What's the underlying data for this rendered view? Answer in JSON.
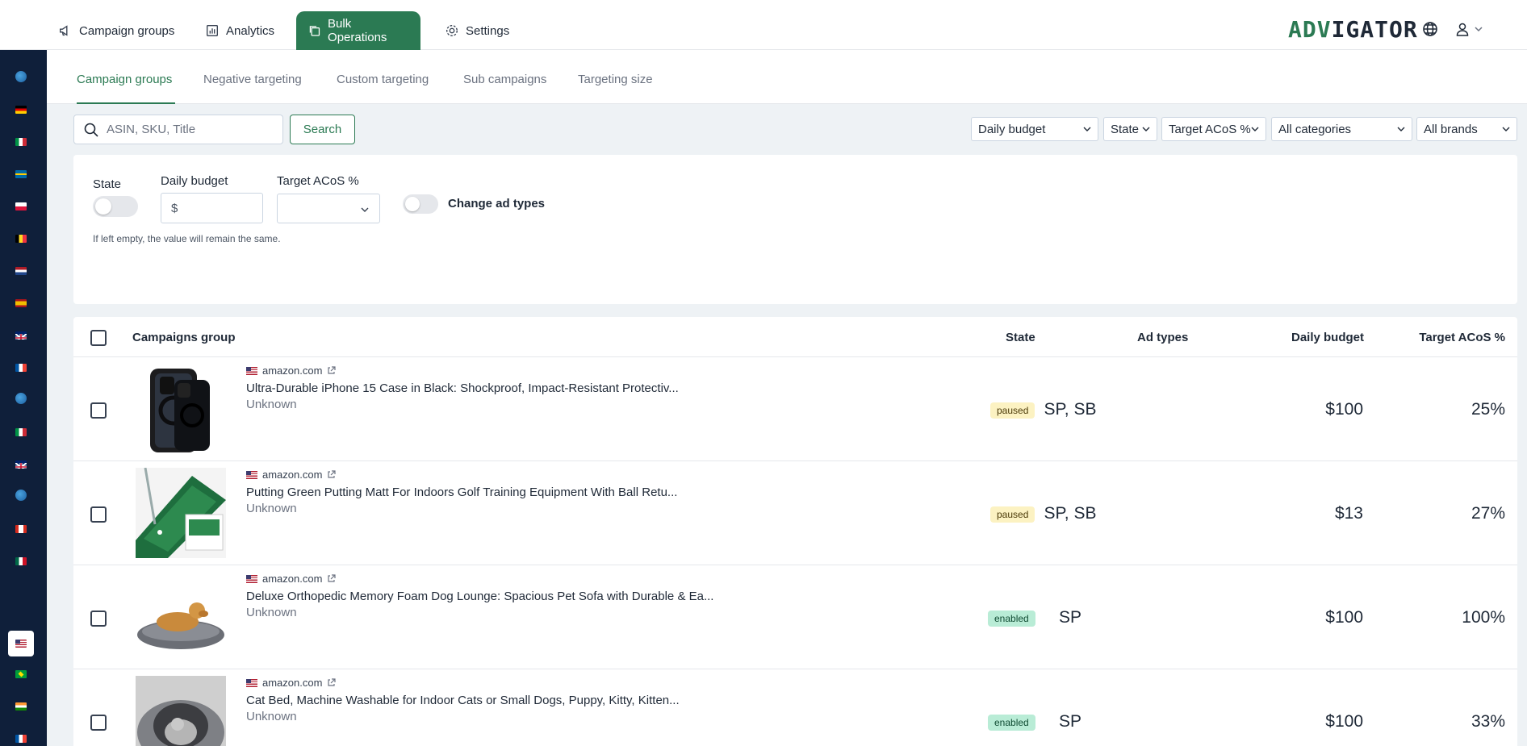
{
  "nav": {
    "items": [
      {
        "label": "Campaign groups",
        "icon": "megaphone-icon"
      },
      {
        "label": "Analytics",
        "icon": "chart-icon"
      },
      {
        "label": "Bulk Operations",
        "icon": "copy-icon",
        "active": true
      },
      {
        "label": "Settings",
        "icon": "gear-icon"
      }
    ],
    "logo_part1": "ADV",
    "logo_part2": "IGATOR",
    "accent": "#2b7a53"
  },
  "subtabs": [
    "Campaign groups",
    "Negative targeting",
    "Custom targeting",
    "Sub campaigns",
    "Targeting size"
  ],
  "search": {
    "placeholder": "ASIN, SKU, Title",
    "button": "Search"
  },
  "filters": [
    "Daily budget",
    "State",
    "Target ACoS %",
    "All categories",
    "All brands"
  ],
  "panel": {
    "state_label": "State",
    "budget_label": "Daily budget",
    "currency": "$",
    "acos_label": "Target ACoS %",
    "change_ad_types": "Change ad types",
    "hint": "If left empty, the value will remain the same."
  },
  "table": {
    "headers": {
      "group": "Campaigns group",
      "state": "State",
      "ad_types": "Ad types",
      "budget": "Daily budget",
      "acos": "Target ACoS %"
    },
    "rows": [
      {
        "domain": "amazon.com",
        "title": "Ultra-Durable iPhone 15 Case in Black: Shockproof, Impact-Resistant Protectiv...",
        "brand": "Unknown",
        "state": "paused",
        "ad_types": "SP, SB",
        "budget": "$100",
        "acos": "25%"
      },
      {
        "domain": "amazon.com",
        "title": "Putting Green Putting Matt For Indoors Golf Training Equipment With Ball Retu...",
        "brand": "Unknown",
        "state": "paused",
        "ad_types": "SP, SB",
        "budget": "$13",
        "acos": "27%"
      },
      {
        "domain": "amazon.com",
        "title": "Deluxe Orthopedic Memory Foam Dog Lounge: Spacious Pet Sofa with Durable & Ea...",
        "brand": "Unknown",
        "state": "enabled",
        "ad_types": "SP",
        "budget": "$100",
        "acos": "100%"
      },
      {
        "domain": "amazon.com",
        "title": "Cat Bed, Machine Washable for Indoor Cats or Small Dogs, Puppy, Kitty, Kitten...",
        "brand": "Unknown",
        "state": "enabled",
        "ad_types": "SP",
        "budget": "$100",
        "acos": "33%"
      }
    ]
  },
  "sidebar_flags": [
    "globe",
    "de",
    "it",
    "se",
    "pl",
    "be",
    "nl",
    "es",
    "gb",
    "fr",
    "globe",
    "it",
    "gb",
    "globe",
    "ca",
    "mx",
    "us",
    "br",
    "in",
    "fr",
    "it"
  ]
}
